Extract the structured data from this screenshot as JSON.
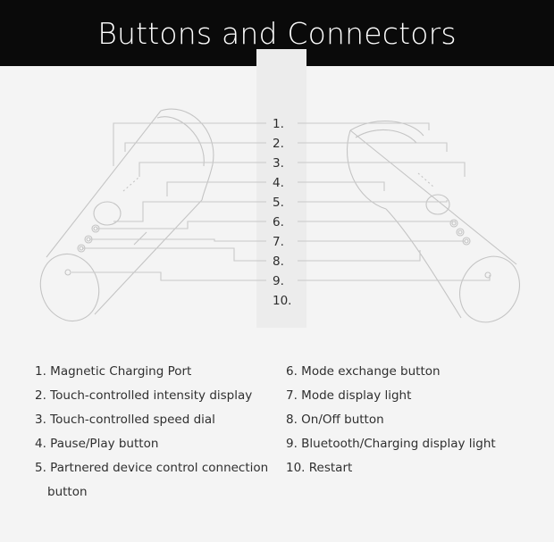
{
  "header": {
    "title": "Buttons and Connectors"
  },
  "callouts": [
    "1.",
    "2.",
    "3.",
    "4.",
    "5.",
    "6.",
    "7.",
    "8.",
    "9.",
    "10."
  ],
  "legend": {
    "left": [
      {
        "text": "1. Magnetic Charging Port"
      },
      {
        "text": "2. Touch-controlled intensity display"
      },
      {
        "text": "3. Touch-controlled speed dial"
      },
      {
        "text": "4. Pause/Play button"
      },
      {
        "text": "5. Partnered device control connection",
        "cont": "button"
      }
    ],
    "right": [
      {
        "text": "6. Mode exchange button"
      },
      {
        "text": "7. Mode display light"
      },
      {
        "text": "8. On/Off button"
      },
      {
        "text": "9. Bluetooth/Charging display light"
      },
      {
        "text": "10. Restart"
      }
    ]
  },
  "colors": {
    "header_bg": "#0a0a0a",
    "header_text": "#ffffff",
    "background": "#f4f4f4",
    "line_art": "#bdbdbd",
    "text": "#2f2f2f"
  }
}
